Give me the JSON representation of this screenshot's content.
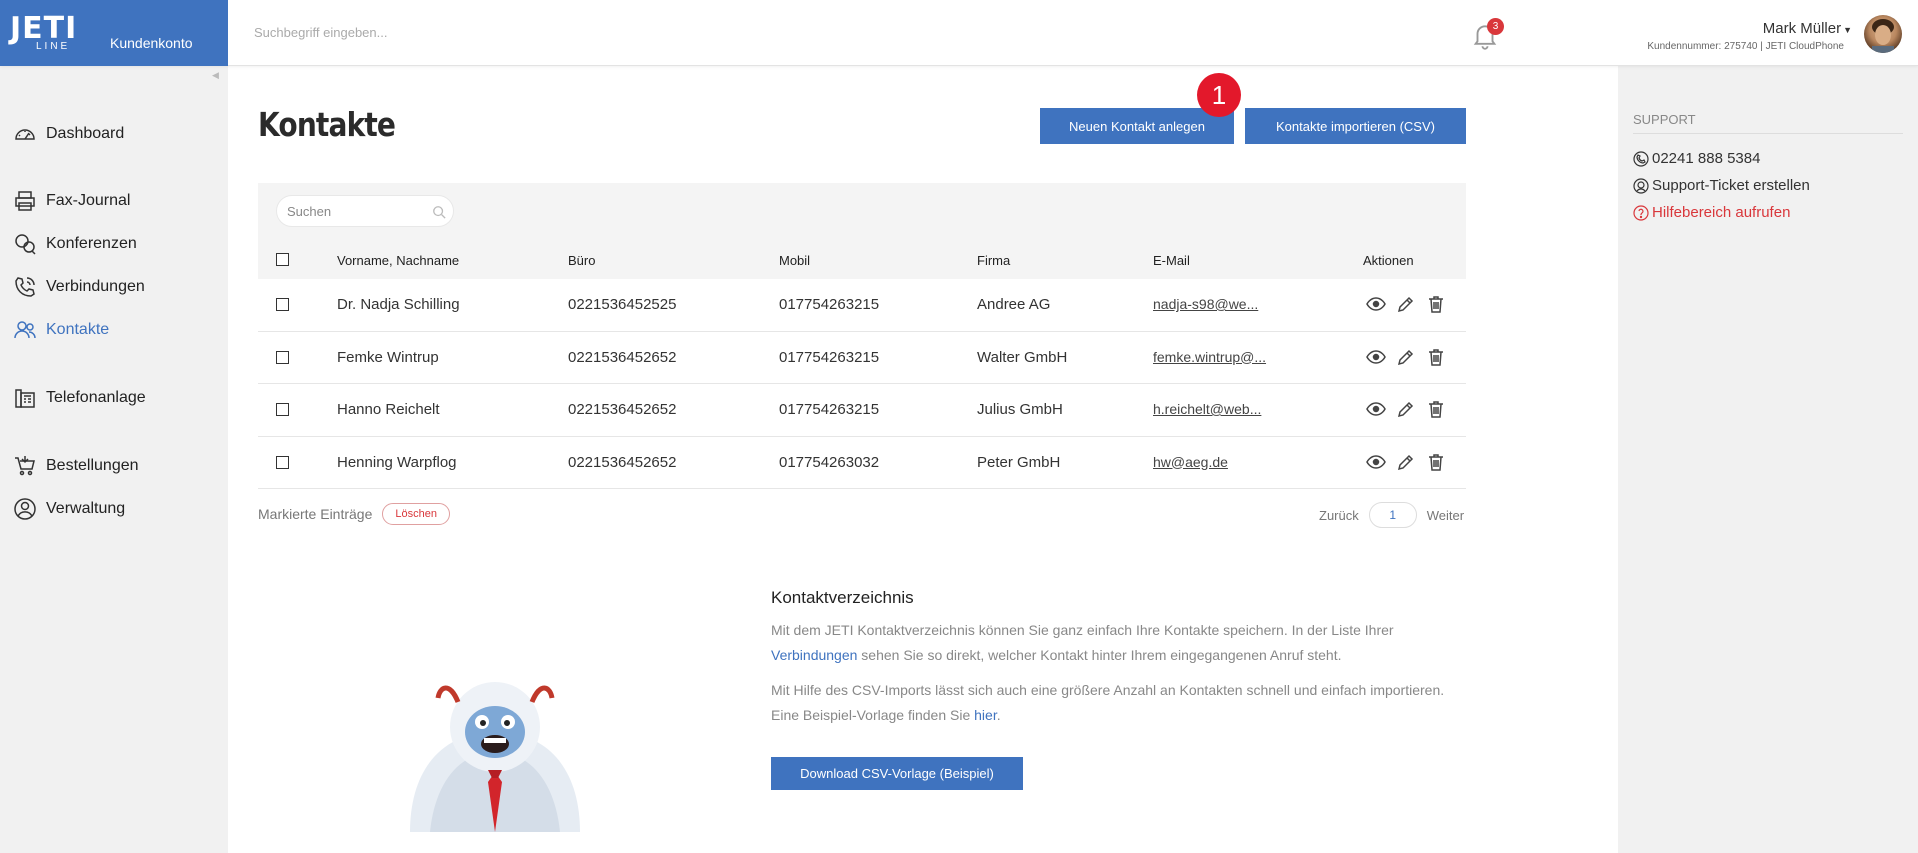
{
  "brand": {
    "logo_top": "JETI",
    "logo_bottom": "LINE",
    "account": "Kundenkonto"
  },
  "header": {
    "search_placeholder": "Suchbegriff eingeben...",
    "notifications_count": "3",
    "user_name": "Mark Müller",
    "user_sub": "Kundennummer: 275740 | JETI CloudPhone"
  },
  "sidebar": {
    "items": [
      {
        "label": "Dashboard",
        "icon": "dashboard-icon"
      },
      {
        "label": "Fax-Journal",
        "icon": "printer-icon"
      },
      {
        "label": "Konferenzen",
        "icon": "conference-icon"
      },
      {
        "label": "Verbindungen",
        "icon": "phone-icon"
      },
      {
        "label": "Kontakte",
        "icon": "contacts-icon"
      },
      {
        "label": "Telefonanlage",
        "icon": "telephone-system-icon"
      },
      {
        "label": "Bestellungen",
        "icon": "cart-icon"
      },
      {
        "label": "Verwaltung",
        "icon": "user-admin-icon"
      }
    ],
    "active": "Kontakte"
  },
  "main": {
    "title": "Kontakte",
    "new_contact_label": "Neuen Kontakt anlegen",
    "import_label": "Kontakte importieren (CSV)",
    "step_badge": "1",
    "search_placeholder": "Suchen",
    "columns": [
      "Vorname, Nachname",
      "Büro",
      "Mobil",
      "Firma",
      "E-Mail",
      "Aktionen"
    ],
    "rows": [
      {
        "name": "Dr. Nadja Schilling",
        "office": "0221536452525",
        "mobile": "017754263215",
        "company": "Andree AG",
        "email": "nadja-s98@we..."
      },
      {
        "name": "Femke Wintrup",
        "office": "0221536452652",
        "mobile": "017754263215",
        "company": "Walter GmbH",
        "email": "femke.wintrup@..."
      },
      {
        "name": "Hanno Reichelt",
        "office": "0221536452652",
        "mobile": "017754263215",
        "company": "Julius GmbH",
        "email": "h.reichelt@web..."
      },
      {
        "name": "Henning Warpflog",
        "office": "0221536452652",
        "mobile": "017754263032",
        "company": "Peter GmbH",
        "email": "hw@aeg.de"
      }
    ],
    "marked_label": "Markierte Einträge",
    "delete_label": "Löschen",
    "pager": {
      "prev": "Zurück",
      "page": "1",
      "next": "Weiter"
    }
  },
  "info": {
    "title": "Kontaktverzeichnis",
    "p1_before": "Mit dem JETI Kontaktverzeichnis können Sie ganz einfach Ihre Kontakte speichern. In der Liste Ihrer ",
    "p1_link": "Verbindungen",
    "p1_after": " sehen Sie so direkt, welcher Kontakt hinter Ihrem eingegangenen Anruf steht.",
    "p2_before": "Mit Hilfe des CSV-Imports lässt sich auch eine größere Anzahl an Kontakten schnell und einfach importieren. Eine Beispiel-Vorlage finden Sie ",
    "p2_link": "hier",
    "p2_after": ".",
    "download_label": "Download CSV-Vorlage (Beispiel)"
  },
  "support": {
    "header": "SUPPORT",
    "phone": "02241 888 5384",
    "ticket": "Support-Ticket erstellen",
    "help": "Hilfebereich aufrufen"
  },
  "colors": {
    "brand": "#3f73bf",
    "sidebar_bg": "#f1f1f1",
    "badge_red": "#e3182b",
    "link_red": "#d9373b"
  }
}
